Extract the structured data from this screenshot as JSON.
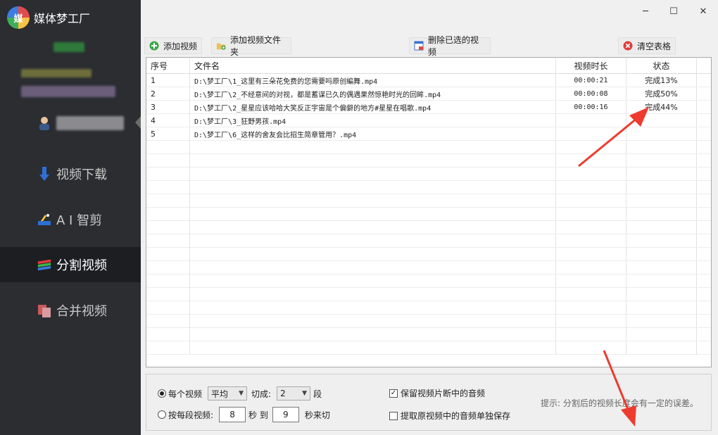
{
  "app": {
    "title": "媒体梦工厂",
    "logo_text": "媒"
  },
  "sidebar": {
    "items": [
      {
        "label": "视频下载",
        "icon": "download-arrow-icon"
      },
      {
        "label": "A I 智剪",
        "icon": "ai-edit-icon"
      },
      {
        "label": "分割视频",
        "icon": "split-video-icon",
        "active": true
      },
      {
        "label": "合并视频",
        "icon": "merge-video-icon"
      }
    ]
  },
  "window": {
    "minimize": "─",
    "maximize": "☐",
    "close": "✕"
  },
  "toolbar": {
    "add_video": "添加视频",
    "add_folder": "添加视频文件夹",
    "delete_selected": "删除已选的视频",
    "clear_table": "清空表格"
  },
  "table": {
    "headers": {
      "no": "序号",
      "name": "文件名",
      "duration": "视频时长",
      "status": "状态"
    },
    "rows": [
      {
        "no": "1",
        "name": "D:\\梦工厂\\1_这里有三朵花免费的您需要吗原创編舞.mp4",
        "duration": "00:00:21",
        "status": "完成13%"
      },
      {
        "no": "2",
        "name": "D:\\梦工厂\\2_不经意间的对视，都是蓄谋已久的偶遇果然惊艳时光的回眸.mp4",
        "duration": "00:00:08",
        "status": "完成50%"
      },
      {
        "no": "3",
        "name": "D:\\梦工厂\\2_星星应该哈哈大笑反正宇宙是个偏僻的地方#星星在唱歌.mp4",
        "duration": "00:00:16",
        "status": "完成44%"
      },
      {
        "no": "4",
        "name": "D:\\梦工厂\\3_狂野男孩.mp4",
        "duration": "",
        "status": ""
      },
      {
        "no": "5",
        "name": "D:\\梦工厂\\6_这样的舍友会比招生简章管用？.mp4",
        "duration": "",
        "status": ""
      }
    ]
  },
  "options": {
    "each_video": "每个视频",
    "mode_value": "平均",
    "cut_into": "切成:",
    "segments_value": "2",
    "segment_unit": "段",
    "by_segment": "按每段视频:",
    "from_value": "8",
    "sec_to": "秒 到",
    "to_value": "9",
    "sec_cut": "秒来切",
    "keep_audio": "保留视频片断中的音频",
    "extract_audio": "提取原视频中的音频单独保存",
    "hint": "提示: 分割后的视频长度会有一定的误差。"
  },
  "colors": {
    "sidebar_bg": "#2b2d31",
    "active_bg": "#1d1e21",
    "annotation_red": "#ee3b2e"
  }
}
